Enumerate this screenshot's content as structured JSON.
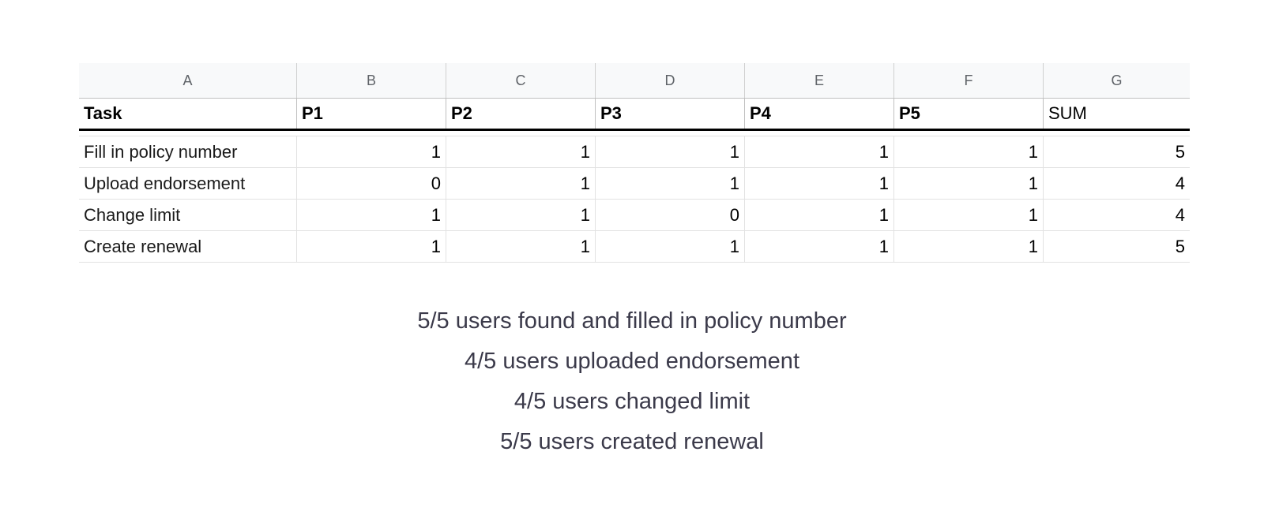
{
  "sheet": {
    "column_letters": [
      "A",
      "B",
      "C",
      "D",
      "E",
      "F",
      "G"
    ],
    "header": [
      "Task",
      "P1",
      "P2",
      "P3",
      "P4",
      "P5",
      "SUM"
    ],
    "rows": [
      {
        "task": "Fill in policy number",
        "values": [
          "1",
          "1",
          "1",
          "1",
          "1",
          "5"
        ]
      },
      {
        "task": "Upload endorsement",
        "values": [
          "0",
          "1",
          "1",
          "1",
          "1",
          "4"
        ]
      },
      {
        "task": "Change limit",
        "values": [
          "1",
          "1",
          "0",
          "1",
          "1",
          "4"
        ]
      },
      {
        "task": "Create renewal",
        "values": [
          "1",
          "1",
          "1",
          "1",
          "1",
          "5"
        ]
      }
    ]
  },
  "summary": [
    "5/5 users found and filled in policy number",
    "4/5 users uploaded endorsement",
    "4/5 users changed limit",
    "5/5 users created renewal"
  ]
}
